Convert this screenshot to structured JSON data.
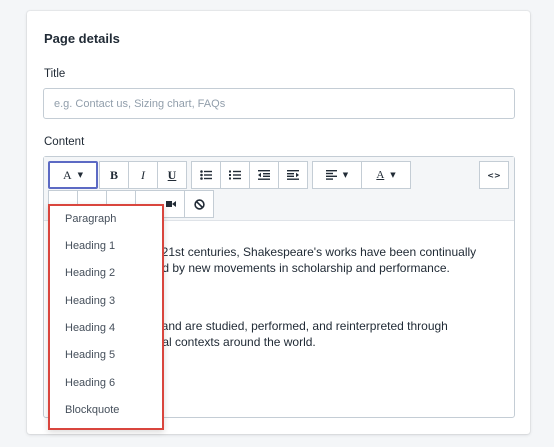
{
  "card": {
    "title": "Page details",
    "title_label": "Title",
    "title_placeholder": "e.g. Contact us, Sizing chart, FAQs",
    "content_label": "Content"
  },
  "toolbar": {
    "format_button": "A",
    "bold": "B",
    "italic": "I",
    "underline": "U",
    "text_color_button": "A",
    "code_view": "<>"
  },
  "editor": {
    "lines": [
      "nd 21st centuries, Shakespeare's works have been continually",
      "ered by new movements in scholarship and performance.",
      "lar and are studied, performed, and reinterpreted through",
      "litical contexts around the world."
    ]
  },
  "format_menu": {
    "items": [
      "Paragraph",
      "Heading 1",
      "Heading 2",
      "Heading 3",
      "Heading 4",
      "Heading 5",
      "Heading 6",
      "Blockquote"
    ]
  },
  "colors": {
    "active_border": "#5c6ac4",
    "highlight_border": "#d9453d"
  }
}
